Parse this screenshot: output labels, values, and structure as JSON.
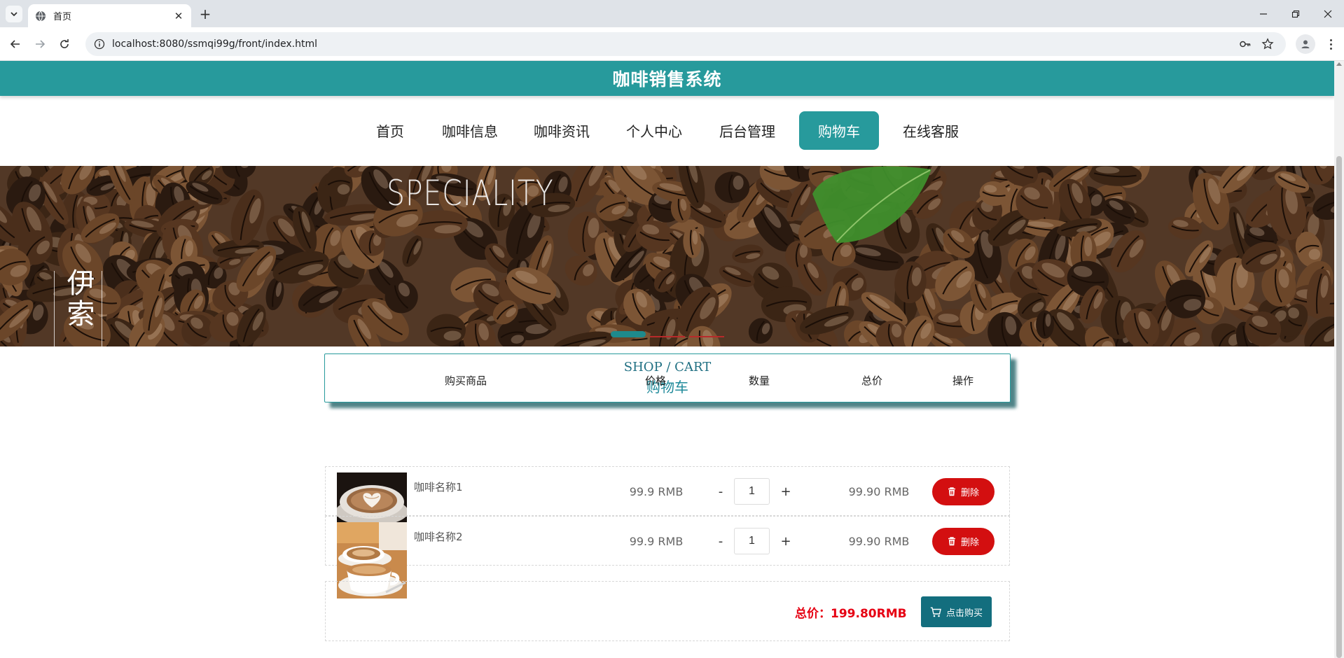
{
  "browser": {
    "tab_title": "首页",
    "url": "localhost:8080/ssmqi99g/front/index.html"
  },
  "site": {
    "title": "咖啡销售系统",
    "accent_color": "#279a9c"
  },
  "nav": {
    "items": [
      {
        "label": "首页"
      },
      {
        "label": "咖啡信息"
      },
      {
        "label": "咖啡资讯"
      },
      {
        "label": "个人中心"
      },
      {
        "label": "后台管理"
      },
      {
        "label": "购物车"
      },
      {
        "label": "在线客服"
      }
    ],
    "active": "购物车"
  },
  "banner": {
    "headline": "SPECIALITY",
    "vertical_text": "伊索",
    "slides_total": 3,
    "slide_active": 1
  },
  "cart": {
    "title_en": "SHOP / CART",
    "title_cn": "购物车",
    "headers": {
      "product": "购买商品",
      "price": "价格",
      "quantity": "数量",
      "total": "总价",
      "action": "操作"
    },
    "items": [
      {
        "name": "咖啡名称1",
        "price": "99.9 RMB",
        "quantity": "1",
        "total": "99.90 RMB",
        "delete_label": "删除",
        "image": "latte-art-icon"
      },
      {
        "name": "咖啡名称2",
        "price": "99.9 RMB",
        "quantity": "1",
        "total": "99.90 RMB",
        "delete_label": "删除",
        "image": "coffee-cup-icon"
      }
    ],
    "minus": "-",
    "plus": "+",
    "summary_label": "总价：199.80RMB",
    "buy_label": "点击购买",
    "delete_color": "#d30f10",
    "buy_color": "#136e7e",
    "total_color": "#e60012"
  }
}
